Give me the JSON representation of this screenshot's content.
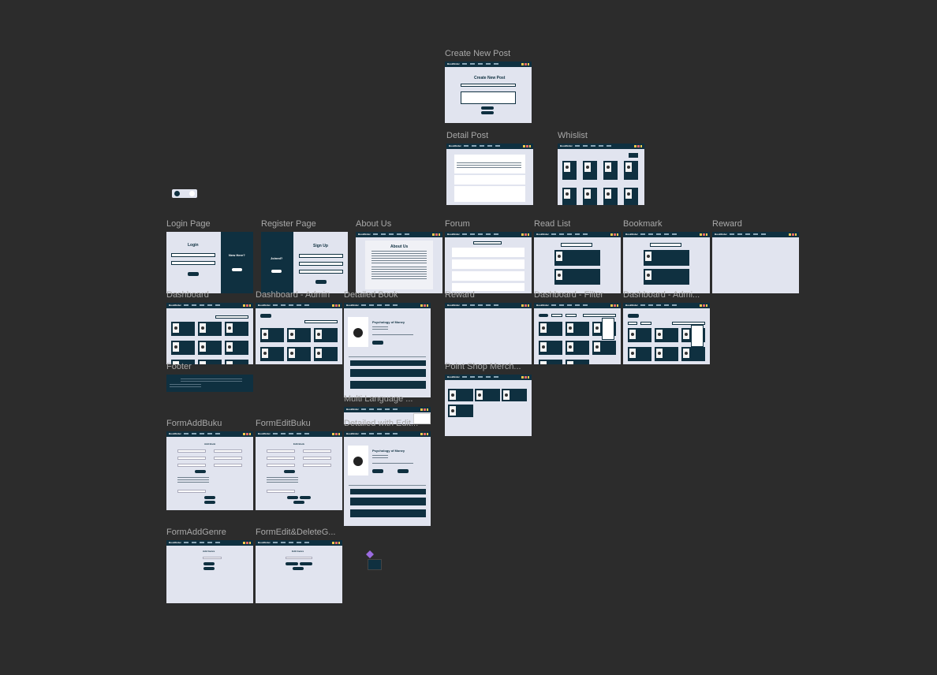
{
  "frames": {
    "create_new_post": {
      "label": "Create New Post",
      "heading": "Create New Post"
    },
    "detail_post": {
      "label": "Detail Post"
    },
    "whislist": {
      "label": "Whislist"
    },
    "login_page": {
      "label": "Login Page",
      "heading": "Login",
      "side_text": "New Here?"
    },
    "register_page": {
      "label": "Register Page",
      "heading": "Sign Up",
      "side_text": "Joined?"
    },
    "about_us": {
      "label": "About Us",
      "heading": "About Us"
    },
    "forum": {
      "label": "Forum"
    },
    "read_list": {
      "label": "Read List"
    },
    "bookmark": {
      "label": "Bookmark"
    },
    "reward_top": {
      "label": "Reward"
    },
    "dashboard": {
      "label": "Dashboard"
    },
    "dashboard_admin": {
      "label": "Dashboard - Admin"
    },
    "detailed_book": {
      "label": "Detailed Book",
      "book_title": "Psychology of Money"
    },
    "reward_mid": {
      "label": "Reward"
    },
    "dashboard_filter": {
      "label": "Dashboard - Filter"
    },
    "dashboard_admin_filter": {
      "label": "Dashboard - Admi..."
    },
    "footer": {
      "label": "Footer"
    },
    "point_shop": {
      "label": "Point Shop Merch..."
    },
    "multi_language": {
      "label": "Multi Language ..."
    },
    "form_add_buku": {
      "label": "FormAddBuku",
      "heading": "Add Book"
    },
    "form_edit_buku": {
      "label": "FormEditBuku",
      "heading": "Edit Book"
    },
    "detailed_edit": {
      "label": "Detailed with Edit...",
      "book_title": "Psychology of Money"
    },
    "form_add_genre": {
      "label": "FormAddGenre",
      "heading": "Add Genre"
    },
    "form_edit_delete_genre": {
      "label": "FormEdit&DeleteG...",
      "heading": "Edit Genre"
    }
  },
  "colors": {
    "canvas": "#2c2c2c",
    "frame_bg": "#e1e4ef",
    "navy": "#0f3040",
    "label": "#a8a8a8"
  },
  "icons": [
    "theme-toggle-icon",
    "component-icon"
  ]
}
